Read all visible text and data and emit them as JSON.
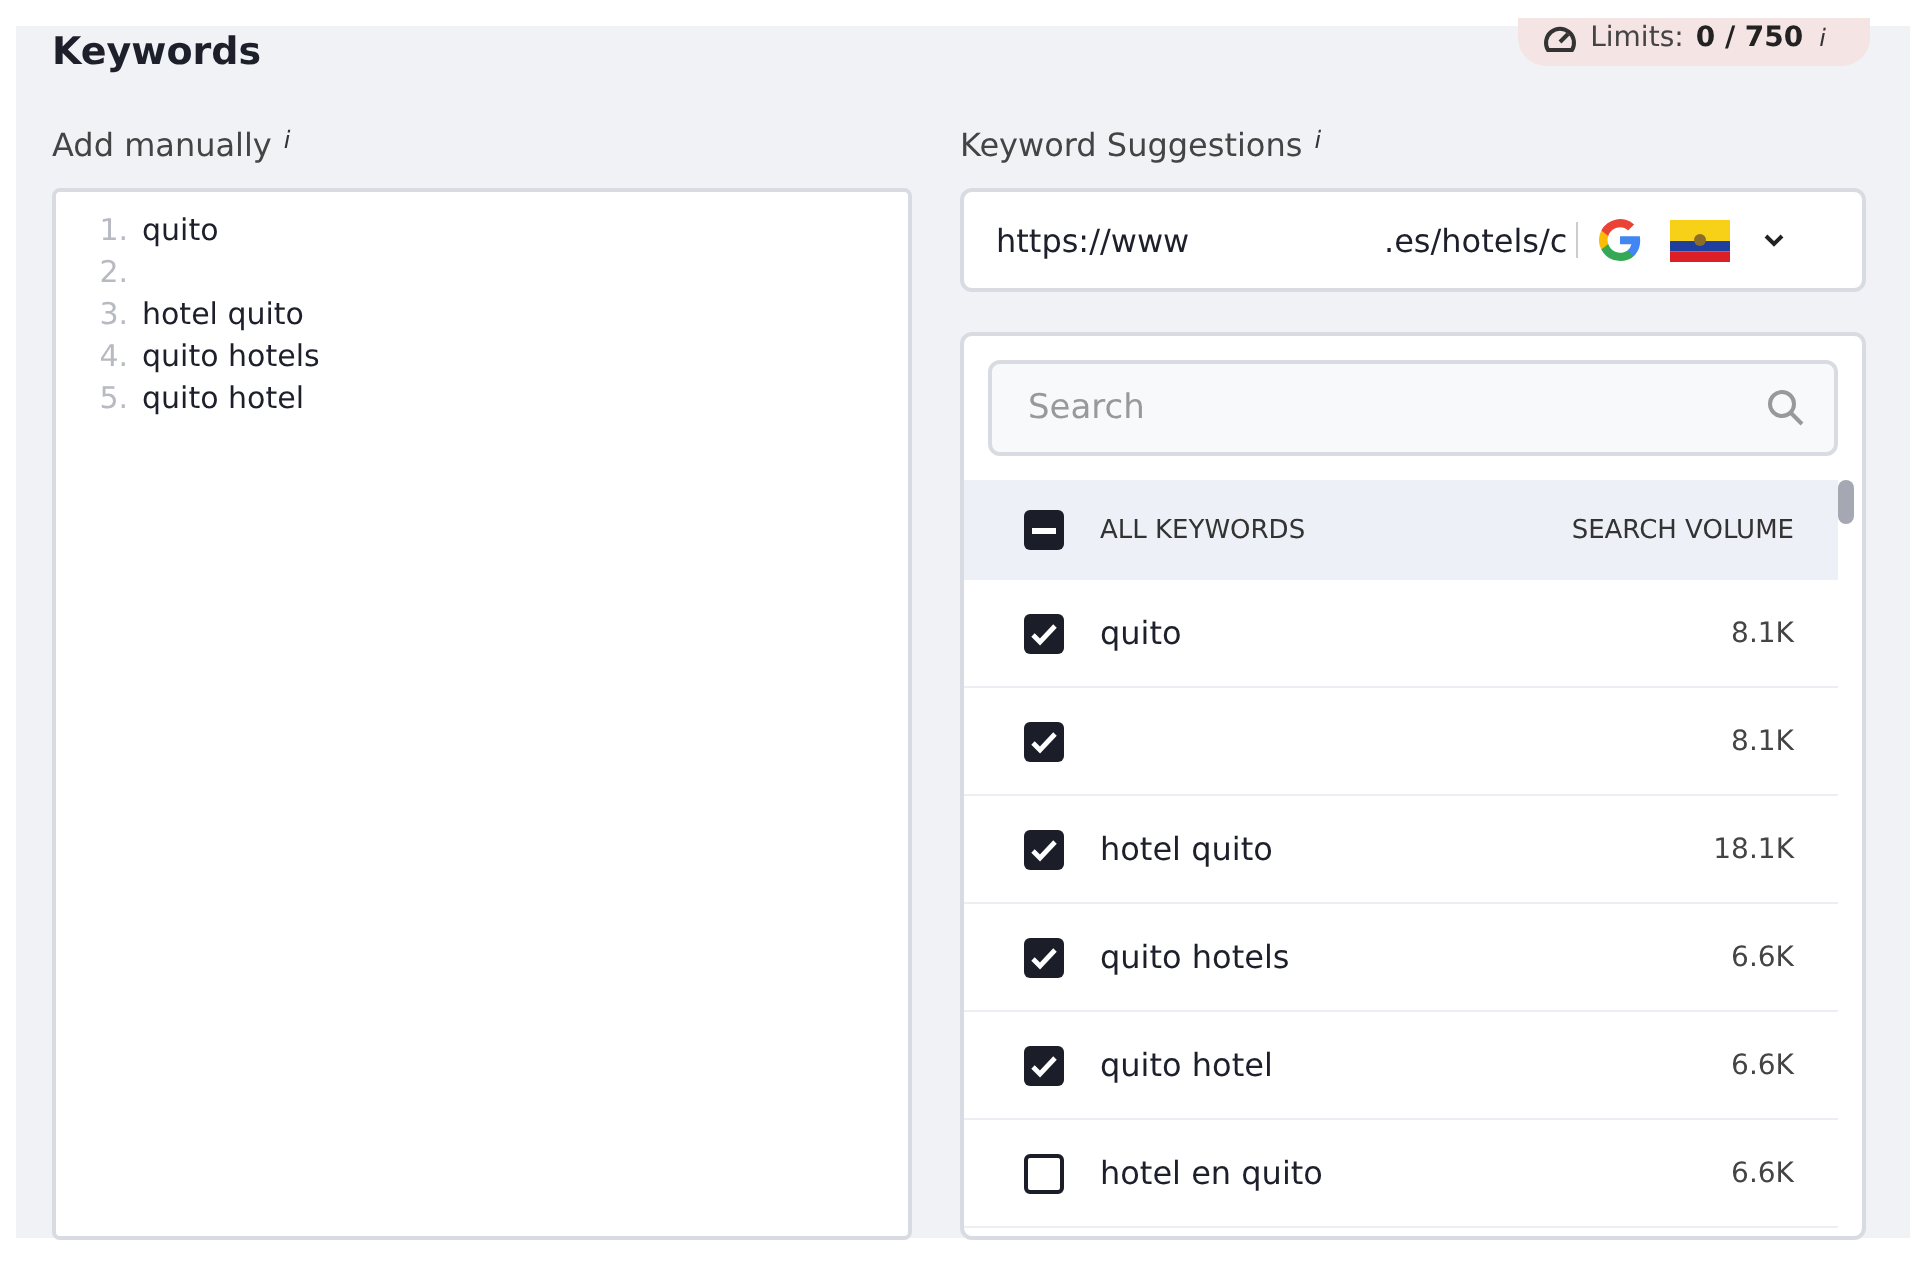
{
  "title": "Keywords",
  "limits": {
    "label": "Limits:",
    "value": "0 / 750",
    "info": "i"
  },
  "manual": {
    "label": "Add manually",
    "info": "i",
    "lines": [
      {
        "number": "1.",
        "text": "quito"
      },
      {
        "number": "2."
      },
      {
        "number": "3.",
        "text": "hotel quito"
      },
      {
        "number": "4.",
        "text": "quito hotels"
      },
      {
        "number": "5.",
        "text": "quito hotel"
      }
    ]
  },
  "suggestions": {
    "label": "Keyword Suggestions",
    "info": "i",
    "url_start": "https://www",
    "url_end": ".es/hotels/c",
    "search": {
      "placeholder": "Search"
    },
    "header": {
      "checked": true,
      "indeterminate": true,
      "keyword": "ALL KEYWORDS",
      "volume": "SEARCH VOLUME"
    },
    "rows": [
      {
        "keyword": "quito",
        "volume": "8.1K",
        "checked": true
      },
      {
        "volume": "8.1K",
        "checked": true
      },
      {
        "keyword": "hotel quito",
        "volume": "18.1K",
        "checked": true
      },
      {
        "keyword": "quito hotels",
        "volume": "6.6K",
        "checked": true
      },
      {
        "keyword": "quito hotel",
        "volume": "6.6K",
        "checked": true
      },
      {
        "keyword": "hotel en quito",
        "volume": "6.6K",
        "checked": false
      }
    ]
  }
}
